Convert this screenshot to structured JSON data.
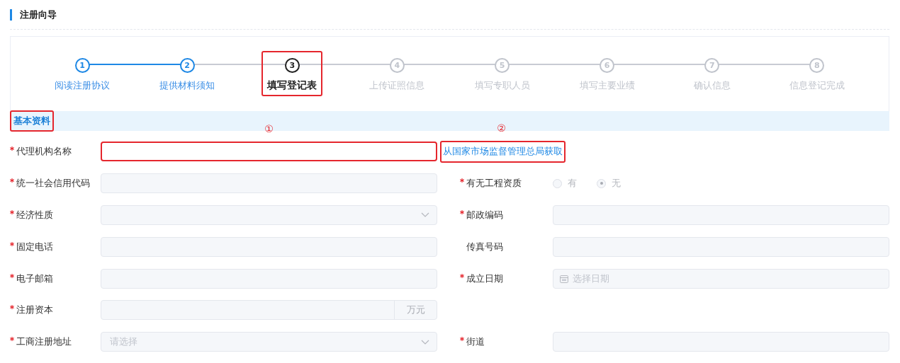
{
  "page_title": "注册向导",
  "steps": [
    {
      "number": "1",
      "label": "阅读注册协议",
      "completed": true,
      "active": false,
      "highlighted": false
    },
    {
      "number": "2",
      "label": "提供材料须知",
      "completed": true,
      "active": false,
      "highlighted": false
    },
    {
      "number": "3",
      "label": "填写登记表",
      "completed": false,
      "active": true,
      "highlighted": true
    },
    {
      "number": "4",
      "label": "上传证照信息",
      "completed": false,
      "active": false,
      "highlighted": false
    },
    {
      "number": "5",
      "label": "填写专职人员",
      "completed": false,
      "active": false,
      "highlighted": false
    },
    {
      "number": "6",
      "label": "填写主要业绩",
      "completed": false,
      "active": false,
      "highlighted": false
    },
    {
      "number": "7",
      "label": "确认信息",
      "completed": false,
      "active": false,
      "highlighted": false
    },
    {
      "number": "8",
      "label": "信息登记完成",
      "completed": false,
      "active": false,
      "highlighted": false
    }
  ],
  "section": {
    "title": "基本资料",
    "highlighted": true
  },
  "rows": [
    {
      "left": {
        "kind": "text",
        "label": "代理机构名称",
        "required": true,
        "highlighted": true,
        "callout": "①"
      },
      "right": {
        "kind": "link",
        "text": "从国家市场监督管理总局获取",
        "highlighted": true,
        "callout": "②"
      }
    },
    {
      "left": {
        "kind": "text",
        "label": "统一社会信用代码",
        "required": true
      },
      "right": {
        "kind": "radio",
        "label": "有无工程资质",
        "required": true,
        "options": [
          {
            "label": "有",
            "selected": false
          },
          {
            "label": "无",
            "selected": true
          }
        ]
      }
    },
    {
      "left": {
        "kind": "select",
        "label": "经济性质",
        "required": true
      },
      "right": {
        "kind": "text",
        "label": "邮政编码",
        "required": true
      }
    },
    {
      "left": {
        "kind": "text",
        "label": "固定电话",
        "required": true
      },
      "right": {
        "kind": "text",
        "label": "传真号码",
        "required": false
      }
    },
    {
      "left": {
        "kind": "text",
        "label": "电子邮箱",
        "required": true
      },
      "right": {
        "kind": "date",
        "label": "成立日期",
        "required": true,
        "placeholder": "选择日期"
      }
    },
    {
      "left": {
        "kind": "suffix",
        "label": "注册资本",
        "required": true,
        "suffix": "万元"
      }
    },
    {
      "left": {
        "kind": "select",
        "label": "工商注册地址",
        "required": true,
        "placeholder": "请选择"
      },
      "right": {
        "kind": "text",
        "label": "街道",
        "required": true
      }
    }
  ]
}
